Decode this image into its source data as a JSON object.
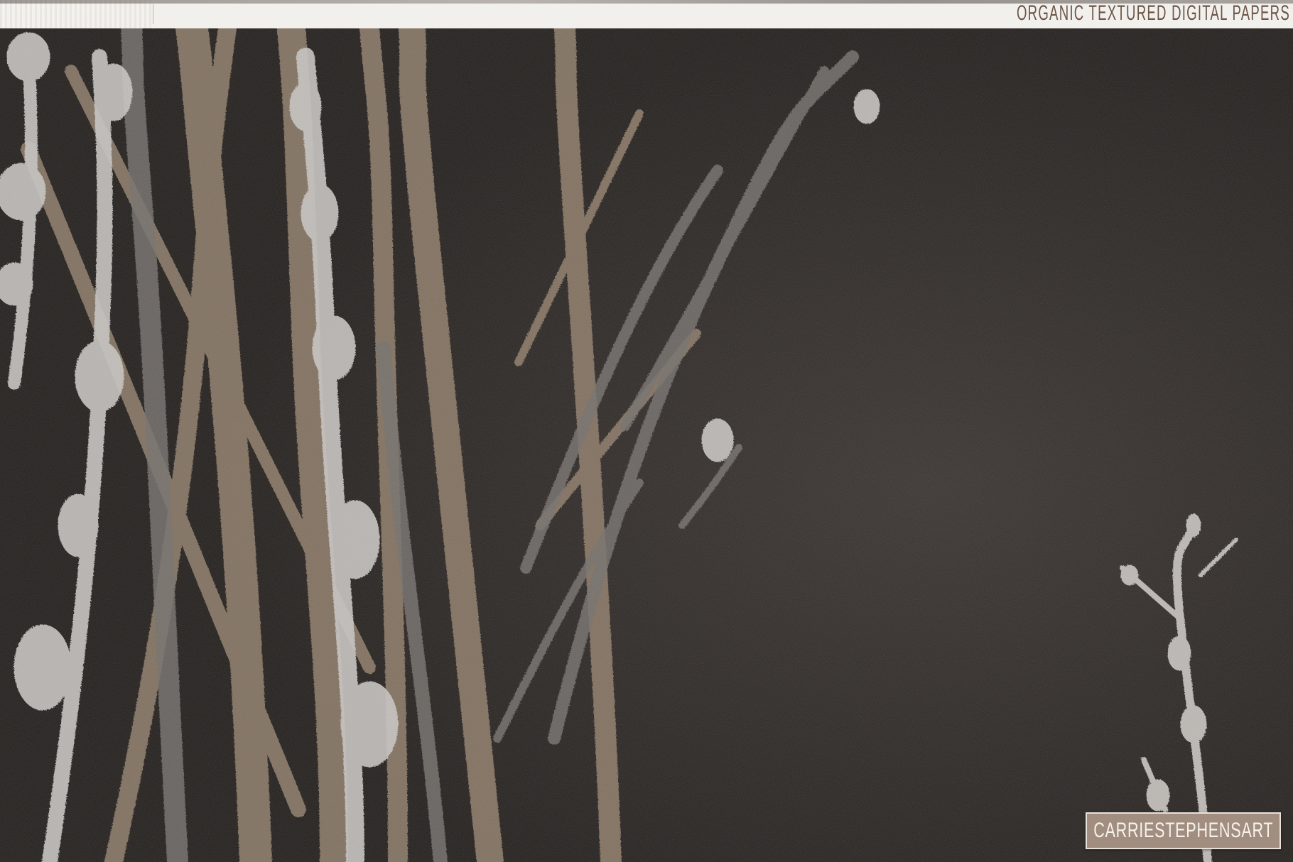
{
  "header": {
    "title": "ORGANIC TEXTURED DIGITAL PAPERS"
  },
  "artwork": {
    "subject": "branch-silhouettes-on-dark-textured-paper",
    "colors": {
      "background": "#2b2624",
      "branch_tan": "#8a7866",
      "branch_grey": "#75706c",
      "branch_light": "#c9c6c3"
    }
  },
  "brand": {
    "label": "CARRIESTEPHENSART",
    "badge_color": "#a18e80"
  }
}
